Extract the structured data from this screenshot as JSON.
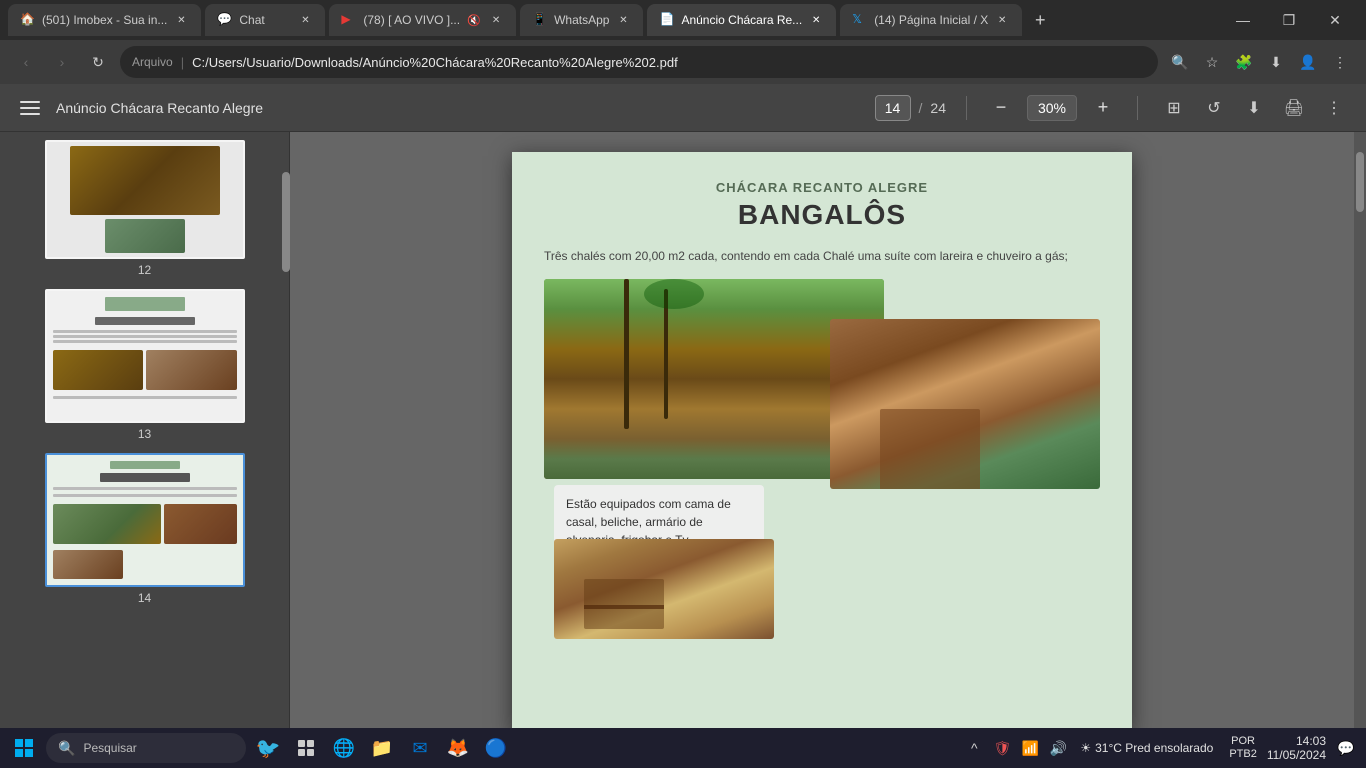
{
  "browser": {
    "tabs": [
      {
        "id": "tab1",
        "favicon": "🏠",
        "title": "(501) Imobex - Sua in...",
        "active": false,
        "color": "#f0a030"
      },
      {
        "id": "tab2",
        "favicon": "💬",
        "title": "Chat",
        "active": false,
        "color": "#4caf50"
      },
      {
        "id": "tab3",
        "favicon": "▶",
        "title": "(78) [ AO VIVO ]...",
        "active": false,
        "muted": true,
        "color": "#e53935"
      },
      {
        "id": "tab4",
        "favicon": "📱",
        "title": "WhatsApp",
        "active": false,
        "color": "#25d366"
      },
      {
        "id": "tab5",
        "favicon": "📄",
        "title": "Anúncio Chácara Re...",
        "active": true,
        "color": "#4a90d9"
      },
      {
        "id": "tab6",
        "favicon": "🐦",
        "title": "(14) Página Inicial / X",
        "active": false,
        "color": "#1da1f2"
      }
    ],
    "url_file_label": "Arquivo",
    "url_path": "C:/Users/Usuario/Downloads/Anúncio%20Chácara%20Recanto%20Alegre%202.pdf"
  },
  "pdf_toolbar": {
    "title": "Anúncio Chácara Recanto Alegre",
    "current_page": "14",
    "total_pages": "24",
    "zoom": "30%"
  },
  "thumbnails": [
    {
      "id": 12,
      "label": "12",
      "selected": false
    },
    {
      "id": 13,
      "label": "13",
      "selected": false
    },
    {
      "id": 14,
      "label": "14",
      "selected": true
    }
  ],
  "pdf_page": {
    "header": "CHÁCARA RECANTO ALEGRE",
    "title": "BANGALÔS",
    "intro": "Três chalés com 20,00 m2 cada, contendo em cada Chalé uma suíte com lareira e chuveiro a gás;",
    "caption": "Estão equipados com cama de casal, beliche, armário de alvenaria, frigobar e Tv."
  },
  "taskbar": {
    "search_placeholder": "Pesquisar",
    "weather": "31°C  Pred ensolarado",
    "time": "14:03",
    "date": "11/05/2024",
    "lang_line1": "POR",
    "lang_line2": "PTB2"
  }
}
